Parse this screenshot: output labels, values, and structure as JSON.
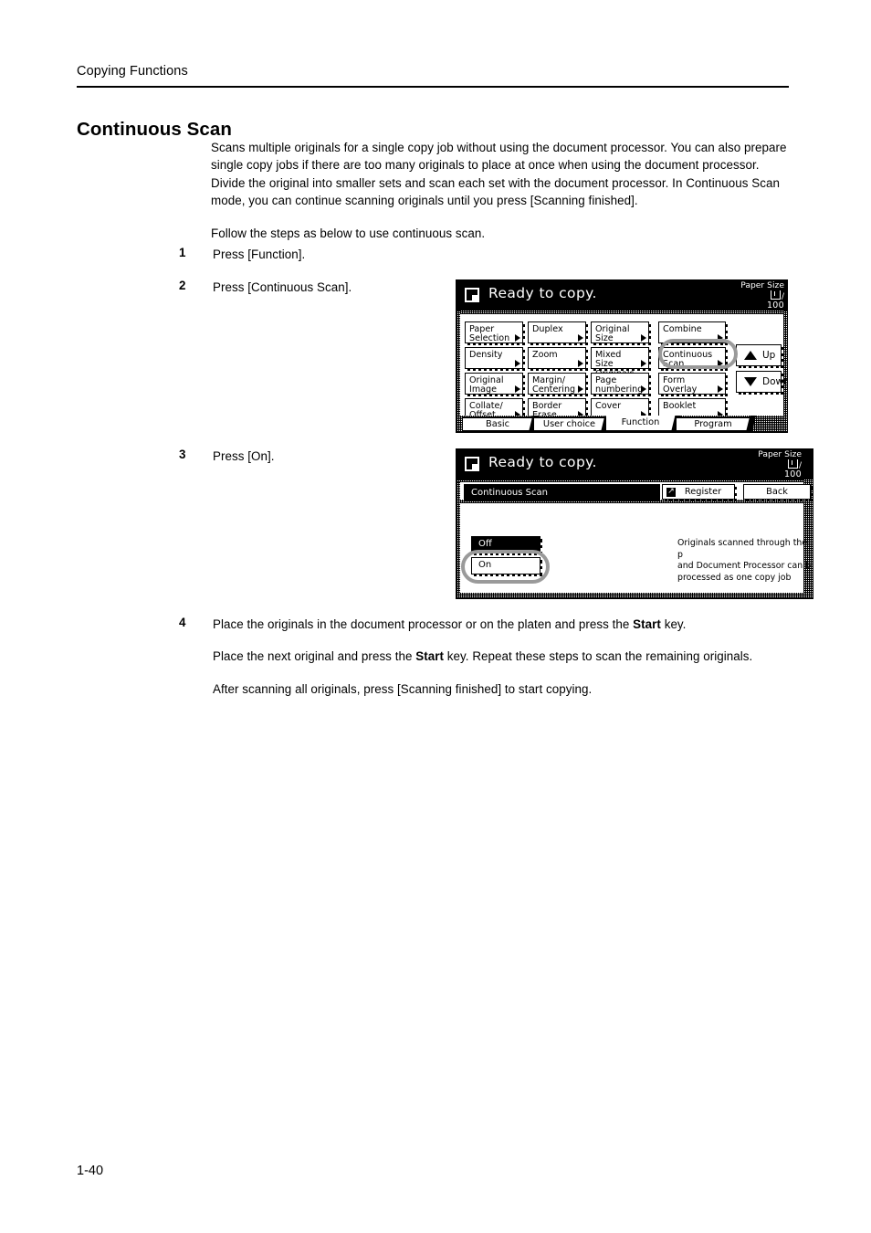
{
  "header": {
    "running_head": "Copying Functions"
  },
  "title": "Continuous Scan",
  "intro": {
    "p1": "Scans multiple originals for a single copy job without using the document processor. You can also prepare single copy jobs if there are too many originals to place at once when using the document processor. Divide the original into smaller sets and scan each set with the document processor. In Continuous Scan mode, you can continue scanning originals until you press [Scanning finished].",
    "p2": "Follow the steps as below to use continuous scan."
  },
  "steps": [
    {
      "num": "1",
      "lines": [
        "Press [Function]."
      ]
    },
    {
      "num": "2",
      "lines": [
        "Press [Continuous Scan]."
      ]
    },
    {
      "num": "3",
      "lines": [
        "Press [On]."
      ]
    },
    {
      "num": "4",
      "lines": [
        "Place the originals in the document processor or on the platen and press the Start key.",
        "Place the next original and press the Start key. Repeat these steps to scan the remaining originals.",
        "After scanning all originals, press [Scanning finished] to start copying."
      ]
    }
  ],
  "panel1": {
    "status": "Ready to copy.",
    "paper_size_label": "Paper Size",
    "paper_size_value": "100",
    "keys": [
      "Paper Selection",
      "Duplex",
      "Original Size",
      "Combine",
      "Density",
      "Zoom",
      "Mixed Size Originals",
      "Continuous Scan",
      "Original Image",
      "Margin/ Centering",
      "Page numbering",
      "Form Overlay",
      "Collate/ Offset",
      "Border Erase",
      "Cover",
      "Booklet"
    ],
    "keys_lines": [
      [
        "Paper",
        "Selection"
      ],
      [
        "Duplex",
        ""
      ],
      [
        "Original",
        "Size"
      ],
      [
        "Combine",
        ""
      ],
      [
        "Density",
        ""
      ],
      [
        "Zoom",
        ""
      ],
      [
        "Mixed Size",
        "Originals"
      ],
      [
        "Continuous",
        "Scan"
      ],
      [
        "Original",
        "Image"
      ],
      [
        "Margin/",
        "Centering"
      ],
      [
        "Page",
        "numbering"
      ],
      [
        "Form",
        "Overlay"
      ],
      [
        "Collate/",
        "Offset"
      ],
      [
        "Border",
        "Erase"
      ],
      [
        "Cover",
        ""
      ],
      [
        "Booklet",
        ""
      ]
    ],
    "nav": {
      "up": "Up",
      "down": "Down"
    },
    "tabs": [
      {
        "label": "Basic",
        "selected": false
      },
      {
        "label": "User choice",
        "selected": false
      },
      {
        "label": "Function",
        "selected": true
      },
      {
        "label": "Program",
        "selected": false
      }
    ],
    "highlighted_key": "Continuous Scan"
  },
  "panel2": {
    "status": "Ready to copy.",
    "paper_size_label": "Paper Size",
    "paper_size_value": "100",
    "subtitle": "Continuous Scan",
    "register_label": "Register",
    "back_label": "Back",
    "options": [
      {
        "label": "Off",
        "selected": true,
        "highlighted": false
      },
      {
        "label": "On",
        "selected": false,
        "highlighted": true
      }
    ],
    "description": [
      "Originals scanned through the p",
      "and Document Processor can b",
      "processed as one copy job"
    ]
  },
  "footer": {
    "folio": "1-40"
  },
  "colors": {
    "highlight_ring": "#9a9a9a",
    "panel_bar": "#000000"
  }
}
